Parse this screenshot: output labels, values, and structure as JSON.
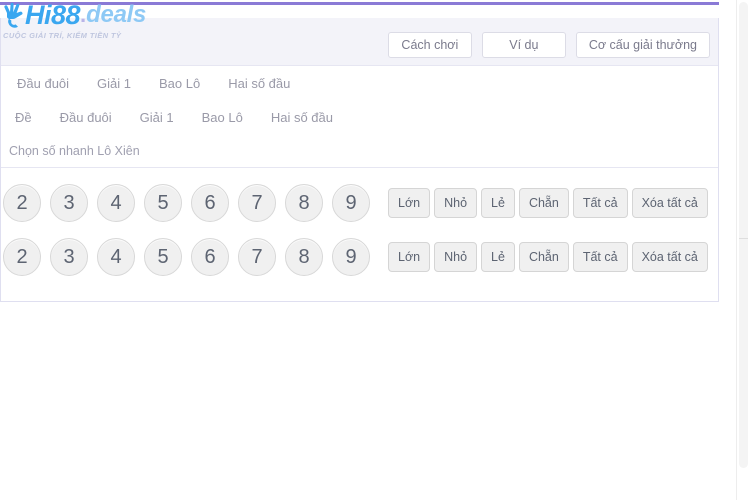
{
  "brand": {
    "name_primary": "Hi88",
    "name_dot": ".",
    "name_secondary": "deals",
    "tagline": "CUỘC GIẢI TRÍ, KIẾM TIỀN TỶ",
    "color_primary": "#3aa7f0",
    "color_secondary": "#8ec9f5",
    "accent_bar_color": "#8a7ad6"
  },
  "header": {
    "buttons": [
      {
        "label": "Cách chơi"
      },
      {
        "label": "Ví dụ"
      },
      {
        "label": "Cơ cấu giải thưởng"
      }
    ]
  },
  "nav_primary": {
    "cut_off_item": "",
    "items": [
      {
        "label": "Đầu đuôi"
      },
      {
        "label": "Giải 1"
      },
      {
        "label": "Bao Lô"
      },
      {
        "label": "Hai số đầu"
      }
    ]
  },
  "nav_secondary": {
    "items": [
      {
        "label": "Đề"
      },
      {
        "label": "Đầu đuôi"
      },
      {
        "label": "Giải 1"
      },
      {
        "label": "Bao Lô"
      },
      {
        "label": "Hai số đầu"
      }
    ]
  },
  "quick_pick": {
    "label": "Chọn số nhanh Lô Xiên"
  },
  "number_rows": [
    {
      "numbers": [
        "2",
        "3",
        "4",
        "5",
        "6",
        "7",
        "8",
        "9"
      ],
      "quick_buttons": [
        "Lớn",
        "Nhỏ",
        "Lẻ",
        "Chẵn",
        "Tất cả",
        "Xóa tất cả"
      ]
    },
    {
      "numbers": [
        "2",
        "3",
        "4",
        "5",
        "6",
        "7",
        "8",
        "9"
      ],
      "quick_buttons": [
        "Lớn",
        "Nhỏ",
        "Lẻ",
        "Chẵn",
        "Tất cả",
        "Xóa tất cả"
      ]
    }
  ]
}
